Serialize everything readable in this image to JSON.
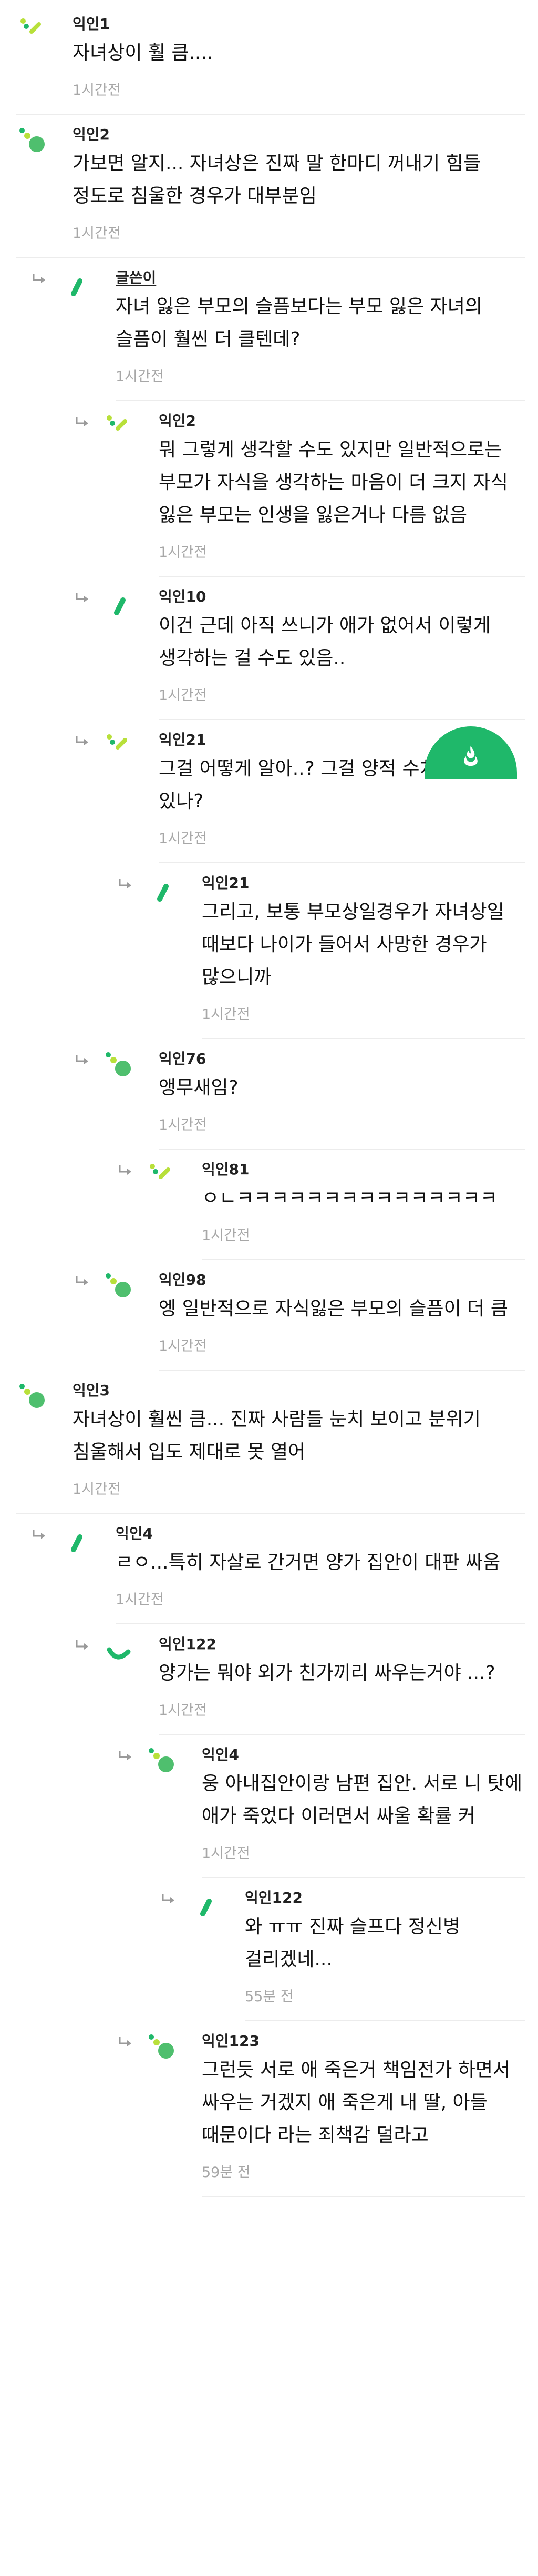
{
  "colors": {
    "accent": "#1fb86a",
    "lime": "#b8e03a",
    "time": "#a7a7a7"
  },
  "fab": {
    "icon": "fire-icon"
  },
  "comments": [
    {
      "depth": 0,
      "avatar": "lime-slash",
      "author": "익인1",
      "body": "자녀상이 훨 큼....",
      "time": "1시간전"
    },
    {
      "depth": 0,
      "avatar": "green-dot",
      "author": "익인2",
      "body": "가보면 알지... 자녀상은 진짜 말 한마디 꺼내기 힘들 정도로 침울한 경우가 대부분임",
      "time": "1시간전"
    },
    {
      "depth": 1,
      "avatar": "green-slash",
      "author": "글쓴이",
      "op": true,
      "body": "자녀 잃은 부모의 슬픔보다는 부모 잃은 자녀의 슬픔이 훨씬 더 클텐데?",
      "time": "1시간전"
    },
    {
      "depth": 2,
      "avatar": "lime-slash",
      "author": "익인2",
      "body": "뭐 그렇게 생각할 수도 있지만 일반적으로는 부모가 자식을 생각하는 마음이 더 크지 자식 잃은 부모는 인생을 잃은거나 다름 없음",
      "time": "1시간전"
    },
    {
      "depth": 2,
      "avatar": "green-slash",
      "author": "익인10",
      "body": "이건 근데 아직 쓰니가 애가 없어서 이렇게 생각하는 걸 수도 있음..",
      "time": "1시간전"
    },
    {
      "depth": 2,
      "avatar": "lime-slash",
      "author": "익인21",
      "body": "그걸 어떻게 알아..? 그걸 양적 수치화 할 수 있나?",
      "time": "1시간전"
    },
    {
      "depth": 3,
      "avatar": "green-slash",
      "author": "익인21",
      "body": "그리고, 보통 부모상일경우가 자녀상일 때보다 나이가 들어서 사망한 경우가 많으니까",
      "time": "1시간전"
    },
    {
      "depth": 2,
      "avatar": "green-dot",
      "author": "익인76",
      "body": "앵무새임?",
      "time": "1시간전"
    },
    {
      "depth": 3,
      "avatar": "lime-slash",
      "author": "익인81",
      "body": "ㅇㄴㅋㅋㅋㅋㅋㅋㅋㅋㅋㅋㅋㅋㅋㅋㅋ",
      "time": "1시간전"
    },
    {
      "depth": 2,
      "avatar": "green-dot",
      "author": "익인98",
      "body": "엥 일반적으로 자식잃은 부모의 슬픔이 더 큼",
      "time": "1시간전"
    },
    {
      "depth": 0,
      "avatar": "green-dot",
      "author": "익인3",
      "body": "자녀상이 훨씬 큼... 진짜 사람들 눈치 보이고 분위기 침울해서 입도 제대로 못 열어",
      "time": "1시간전"
    },
    {
      "depth": 1,
      "avatar": "green-slash",
      "author": "익인4",
      "body": "ㄹㅇ...특히 자살로 간거면 양가 집안이 대판 싸움",
      "time": "1시간전"
    },
    {
      "depth": 2,
      "avatar": "green-arc",
      "author": "익인122",
      "body": "양가는 뭐야 외가 친가끼리 싸우는거야 ...?",
      "time": "1시간전"
    },
    {
      "depth": 3,
      "avatar": "green-dot",
      "author": "익인4",
      "body": "웅 아내집안이랑 남편 집안. 서로 니 탓에 애가 죽었다 이러면서 싸울 확률 커",
      "time": "1시간전"
    },
    {
      "depth": 4,
      "avatar": "green-slash",
      "author": "익인122",
      "body": "와 ㅠㅠ 진짜 슬프다 정신병 걸리겠네...",
      "time": "55분 전"
    },
    {
      "depth": 3,
      "avatar": "green-dot",
      "author": "익인123",
      "body": "그런듯 서로 애 죽은거 책임전가 하면서 싸우는 거겠지 애 죽은게 내 딸, 아들 때문이다 라는 죄책감 덜라고",
      "time": "59분 전"
    }
  ]
}
